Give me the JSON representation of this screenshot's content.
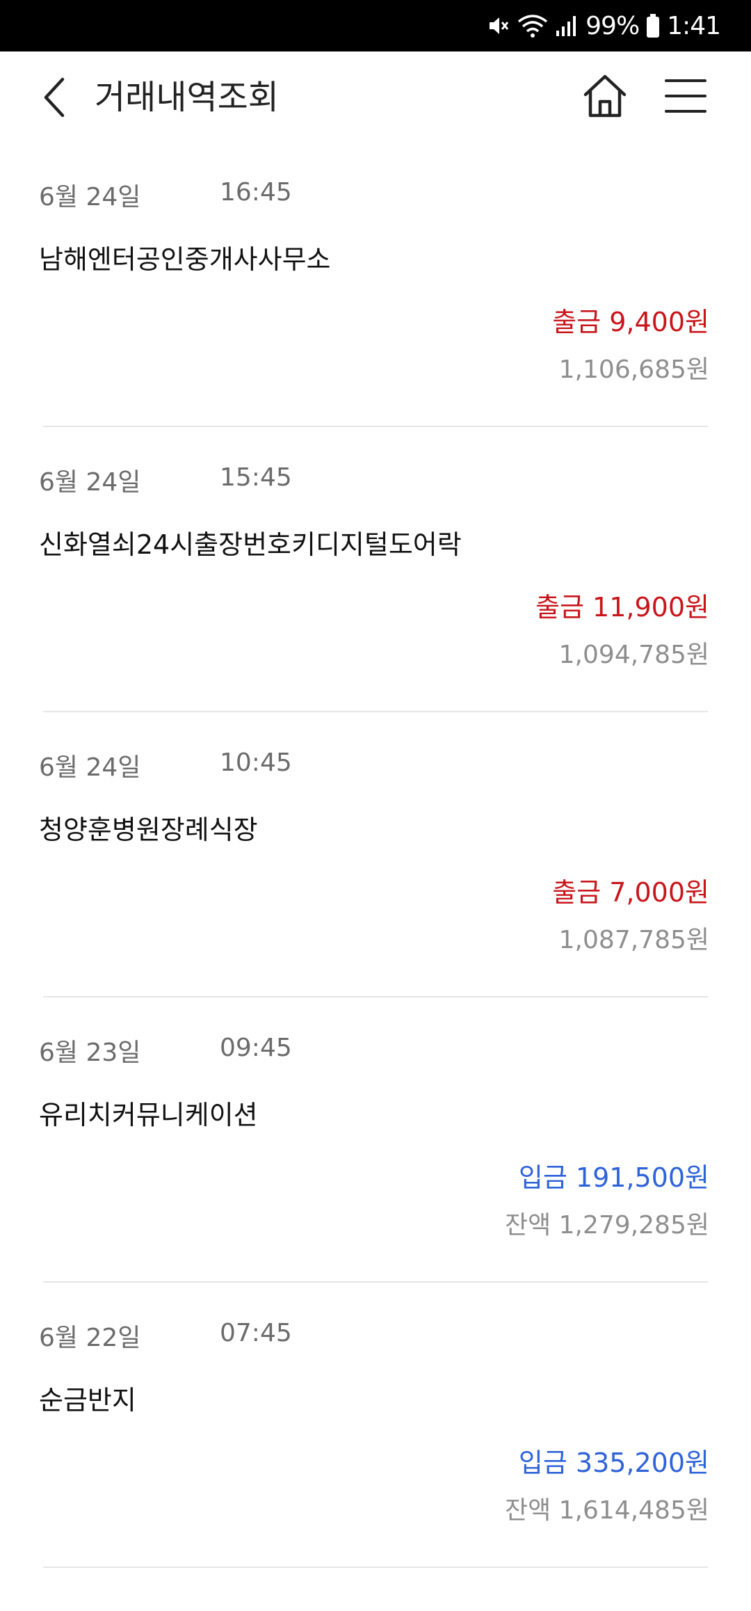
{
  "status_bar": {
    "battery": "99%",
    "time": "1:41",
    "icons": [
      "mute-icon",
      "wifi-icon",
      "signal-icon",
      "battery-icon"
    ]
  },
  "header": {
    "title": "거래내역조회",
    "icons": [
      "back-icon",
      "home-icon",
      "menu-icon"
    ]
  },
  "colors": {
    "withdrawal": "#c8151b",
    "deposit": "#2f63d9",
    "muted": "#8e8e8e"
  },
  "transactions": [
    {
      "date": "6월 24일",
      "time": "16:45",
      "merchant": "남해엔터공인중개사사무소",
      "amount": "출금 9,400원",
      "balance": "1,106,685원"
    },
    {
      "date": "6월 24일",
      "time": "15:45",
      "merchant": "신화열쇠24시출장번호키디지털도어락",
      "amount": "출금 11,900원",
      "balance": "1,094,785원"
    },
    {
      "date": "6월 24일",
      "time": "10:45",
      "merchant": "청양훈병원장례식장",
      "amount": "출금 7,000원",
      "balance": "1,087,785원"
    },
    {
      "date": "6월 23일",
      "time": "09:45",
      "merchant": "유리치커뮤니케이션",
      "amount": "입금 191,500원",
      "balance": "잔액 1,279,285원"
    },
    {
      "date": "6월 22일",
      "time": "07:45",
      "merchant": "순금반지",
      "amount": "입금 335,200원",
      "balance": "잔액 1,614,485원"
    }
  ]
}
